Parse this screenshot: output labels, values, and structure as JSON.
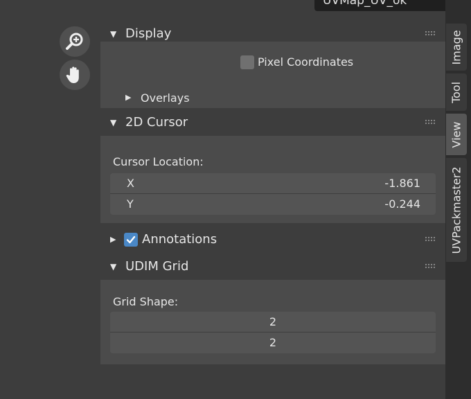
{
  "uv_map": {
    "value": "UVMap_UV_ok"
  },
  "viewport_tools": {
    "zoom_icon": "zoom-in-icon",
    "pan_icon": "hand-icon"
  },
  "panels": {
    "display": {
      "title": "Display",
      "pixel_coordinates_label": "Pixel Coordinates",
      "pixel_coordinates_checked": false,
      "overlays_label": "Overlays"
    },
    "cursor": {
      "title": "2D Cursor",
      "location_label": "Cursor Location:",
      "x_label": "X",
      "x_value": "-1.861",
      "y_label": "Y",
      "y_value": "-0.244"
    },
    "annotations": {
      "title": "Annotations",
      "checked": true
    },
    "udim": {
      "title": "UDIM Grid",
      "shape_label": "Grid Shape:",
      "shape_x": "2",
      "shape_y": "2"
    }
  },
  "tabs": [
    {
      "label": "Image",
      "active": false
    },
    {
      "label": "Tool",
      "active": false
    },
    {
      "label": "View",
      "active": true
    },
    {
      "label": "UVPackmaster2",
      "active": false
    }
  ],
  "colors": {
    "checkbox_checked": "#4a88c7",
    "panel_body": "#4b4b4b"
  }
}
